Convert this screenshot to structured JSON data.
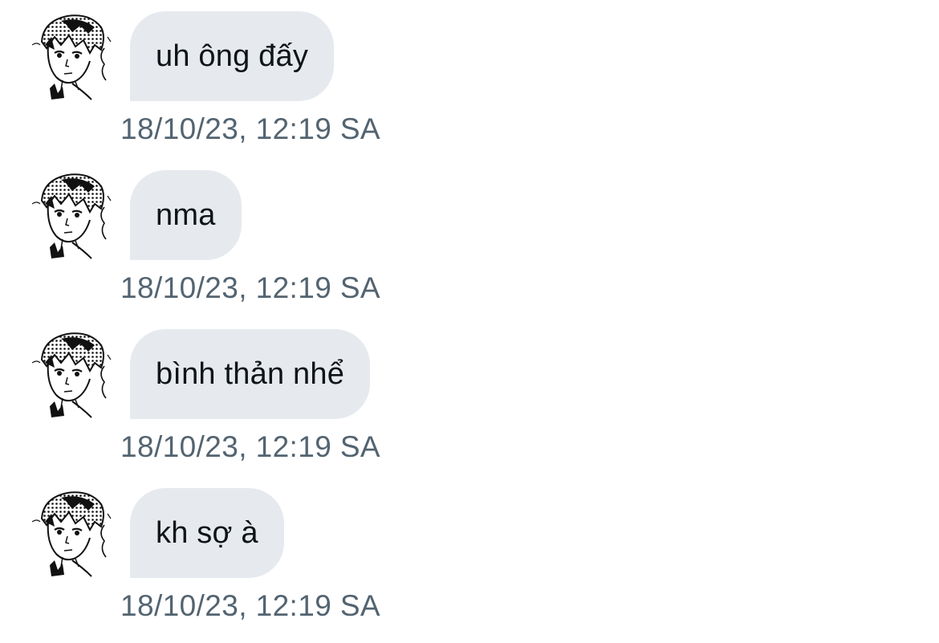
{
  "messages": [
    {
      "text": "uh ông đấy",
      "timestamp": "18/10/23, 12:19 SA",
      "avatar_icon": "manga-character-avatar"
    },
    {
      "text": "nma",
      "timestamp": "18/10/23, 12:19 SA",
      "avatar_icon": "manga-character-avatar"
    },
    {
      "text": "bình thản nhể",
      "timestamp": "18/10/23, 12:19 SA",
      "avatar_icon": "manga-character-avatar"
    },
    {
      "text": "kh sợ à",
      "timestamp": "18/10/23, 12:19 SA",
      "avatar_icon": "manga-character-avatar"
    }
  ],
  "colors": {
    "bubble_background": "#e6eaee",
    "message_text": "#0f1419",
    "timestamp_text": "#536471",
    "page_background": "#ffffff"
  }
}
